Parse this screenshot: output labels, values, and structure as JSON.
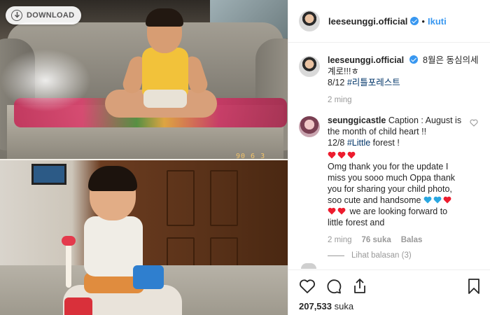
{
  "photo": {
    "download_label": "DOWNLOAD",
    "date_stamp": "90  6  3"
  },
  "header": {
    "username": "leeseunggi.official",
    "separator": "•",
    "follow_label": "Ikuti"
  },
  "caption": {
    "username": "leeseunggi.official",
    "text_line1": "8월은 동심의세",
    "text_line2": "계로!!!ㅎ",
    "text_line3_prefix": "8/12 ",
    "hashtag": "#리틀포레스트",
    "time": "2 ming"
  },
  "comment": {
    "username": "seunggicastle",
    "line1": "Caption : August is",
    "line2": "the month of child heart !!",
    "line3_prefix": "12/8 ",
    "hashtag": "#Little",
    "line3_suffix": " forest !",
    "body_1": "Omg thank you for the update I",
    "body_2": "miss you sooo much Oppa thank",
    "body_3": "you for sharing your child photo,",
    "body_4": "soo cute and handsome",
    "body_5": " we are looking forward to",
    "body_6": "little forest and",
    "time": "2 ming",
    "likes": "76 suka",
    "reply": "Balas",
    "view_replies": "Lihat balasan (3)"
  },
  "actions": {
    "likes_count": "207,533",
    "likes_word": "suka"
  },
  "colors": {
    "link_blue": "#3897f0",
    "hashtag_blue": "#003569",
    "heart_red": "#ed4956",
    "muted": "#999999"
  },
  "icons": [
    "download-icon",
    "verified-icon",
    "heart-icon",
    "comment-icon",
    "share-icon",
    "bookmark-icon",
    "blue-heart-emoji",
    "red-heart-emoji"
  ]
}
